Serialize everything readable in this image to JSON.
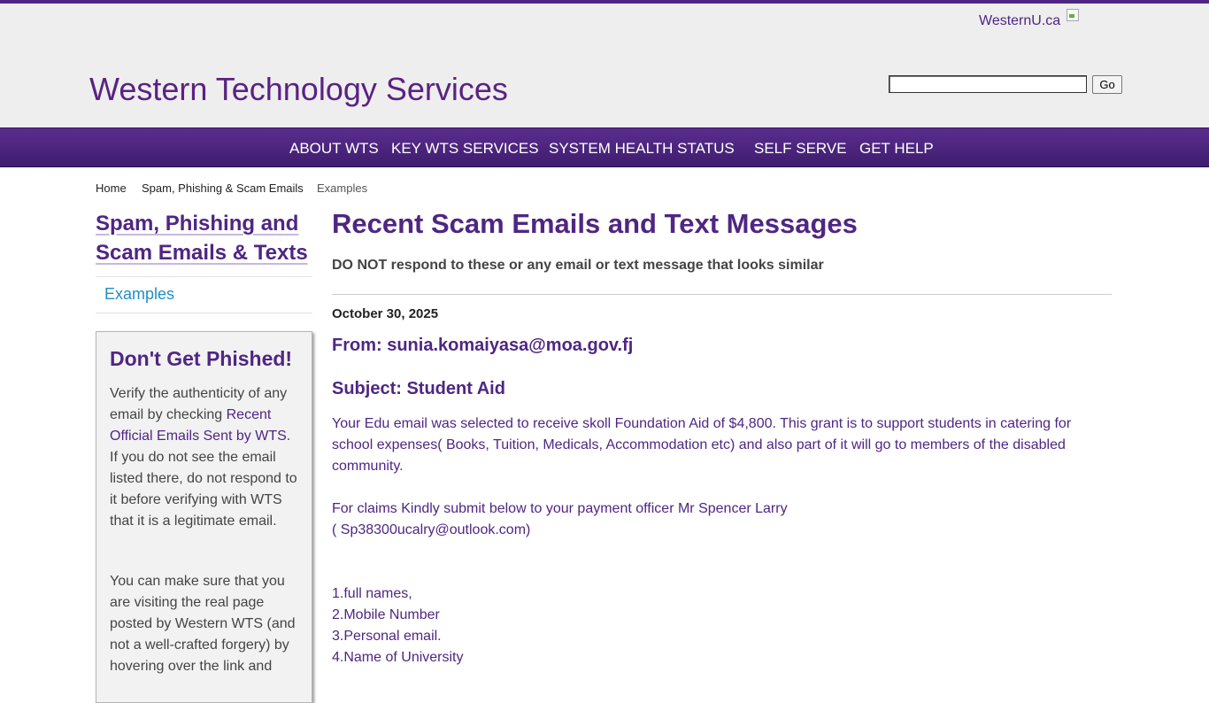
{
  "header": {
    "westernu_link": "WesternU.ca",
    "site_title": "Western Technology Services",
    "search_go": "Go",
    "search_value": ""
  },
  "nav": {
    "items": [
      "ABOUT WTS",
      "KEY WTS SERVICES",
      "SYSTEM HEALTH STATUS",
      "SELF SERVE",
      "GET HELP"
    ]
  },
  "breadcrumb": {
    "home": "Home",
    "section": "Spam, Phishing & Scam Emails",
    "current": "Examples"
  },
  "sidebar": {
    "heading_line1": "Spam, Phishing and",
    "heading_line2": "Scam Emails & Texts",
    "link_examples": "Examples",
    "phish_box": {
      "title": "Don't Get Phished!",
      "p1_before": "Verify the authenticity of any email by checking ",
      "p1_link": "Recent Official Emails Sent by WTS",
      "p1_after": ". If you do not see the email listed there, do not respond to it before verifying with WTS that it is a legitimate email.",
      "p2": "You can make sure that you are visiting the real page posted by Western WTS (and not a well-crafted forgery) by hovering over the link and"
    }
  },
  "main": {
    "title": "Recent Scam Emails and Text Messages",
    "warning": "DO NOT respond to these or any email or text message that looks similar",
    "date": "October 30, 2025",
    "from": "From: sunia.komaiyasa@moa.gov.fj",
    "subject": "Subject: Student Aid",
    "para1": "Your Edu email was selected to receive skoll Foundation Aid of $4,800. This grant is to support students in catering for school expenses( Books, Tuition, Medicals, Accommodation etc) and also part of it will go to members of the disabled community.",
    "para2_line1": "For claims Kindly submit below to your payment officer Mr Spencer Larry",
    "para2_line2": "( Sp38300ucalry@outlook.com)",
    "list": [
      "1.full names,",
      "2.Mobile Number",
      "3.Personal email.",
      "4.Name of University"
    ]
  }
}
